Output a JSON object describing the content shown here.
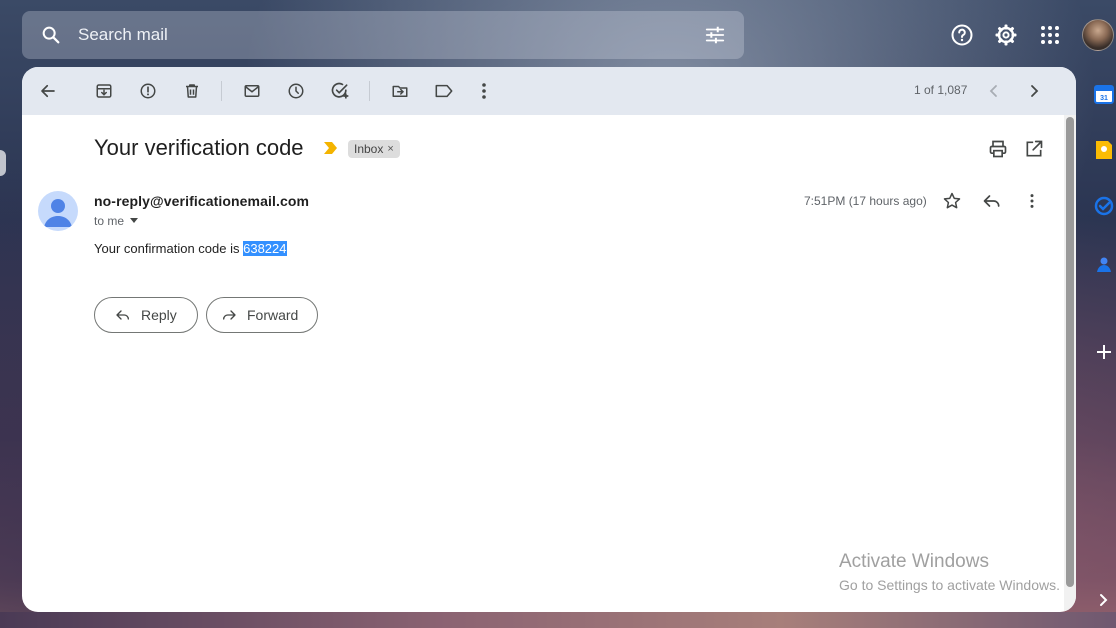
{
  "search": {
    "placeholder": "Search mail"
  },
  "toolbar": {
    "pager": "1 of 1,087"
  },
  "message": {
    "subject": "Your verification code",
    "label": "Inbox",
    "label_close": "×",
    "sender": "no-reply@verificationemail.com",
    "to": "to me",
    "timestamp": "7:51PM (17 hours ago)",
    "body_prefix": "Your confirmation code is ",
    "code": "638224"
  },
  "actions": {
    "reply_label": "Reply",
    "forward_label": "Forward"
  },
  "watermark": {
    "line1": "Activate Windows",
    "line2": "Go to Settings to activate Windows."
  },
  "icons": {
    "search": "search-icon",
    "filter": "tune-icon",
    "help": "help-icon",
    "settings": "gear-icon",
    "apps": "apps-grid-icon"
  },
  "colors": {
    "highlight": "#3390ff",
    "importance": "#f4b400",
    "toolbar_bg": "#e3e8f0"
  }
}
